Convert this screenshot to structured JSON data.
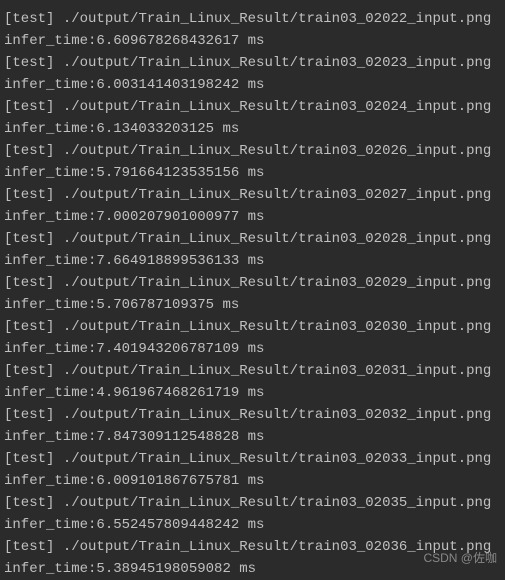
{
  "terminal": {
    "entries": [
      {
        "prefix": "[test]",
        "path": "./output/Train_Linux_Result/train03_02022_input.png",
        "time_label": "infer_time:",
        "time_value": "6.609678268432617 ms"
      },
      {
        "prefix": "[test]",
        "path": "./output/Train_Linux_Result/train03_02023_input.png",
        "time_label": "infer_time:",
        "time_value": "6.003141403198242 ms"
      },
      {
        "prefix": "[test]",
        "path": "./output/Train_Linux_Result/train03_02024_input.png",
        "time_label": "infer_time:",
        "time_value": "6.134033203125 ms"
      },
      {
        "prefix": "[test]",
        "path": "./output/Train_Linux_Result/train03_02026_input.png",
        "time_label": "infer_time:",
        "time_value": "5.791664123535156 ms"
      },
      {
        "prefix": "[test]",
        "path": "./output/Train_Linux_Result/train03_02027_input.png",
        "time_label": "infer_time:",
        "time_value": "7.000207901000977 ms"
      },
      {
        "prefix": "[test]",
        "path": "./output/Train_Linux_Result/train03_02028_input.png",
        "time_label": "infer_time:",
        "time_value": "7.664918899536133 ms"
      },
      {
        "prefix": "[test]",
        "path": "./output/Train_Linux_Result/train03_02029_input.png",
        "time_label": "infer_time:",
        "time_value": "5.706787109375 ms"
      },
      {
        "prefix": "[test]",
        "path": "./output/Train_Linux_Result/train03_02030_input.png",
        "time_label": "infer_time:",
        "time_value": "7.401943206787109 ms"
      },
      {
        "prefix": "[test]",
        "path": "./output/Train_Linux_Result/train03_02031_input.png",
        "time_label": "infer_time:",
        "time_value": "4.961967468261719 ms"
      },
      {
        "prefix": "[test]",
        "path": "./output/Train_Linux_Result/train03_02032_input.png",
        "time_label": "infer_time:",
        "time_value": "7.847309112548828 ms"
      },
      {
        "prefix": "[test]",
        "path": "./output/Train_Linux_Result/train03_02033_input.png",
        "time_label": "infer_time:",
        "time_value": "6.009101867675781 ms"
      },
      {
        "prefix": "[test]",
        "path": "./output/Train_Linux_Result/train03_02035_input.png",
        "time_label": "infer_time:",
        "time_value": "6.552457809448242 ms"
      },
      {
        "prefix": "[test]",
        "path": "./output/Train_Linux_Result/train03_02036_input.png",
        "time_label": "infer_time:",
        "time_value": "5.38945198059082 ms"
      }
    ]
  },
  "watermark": "CSDN @佐咖"
}
